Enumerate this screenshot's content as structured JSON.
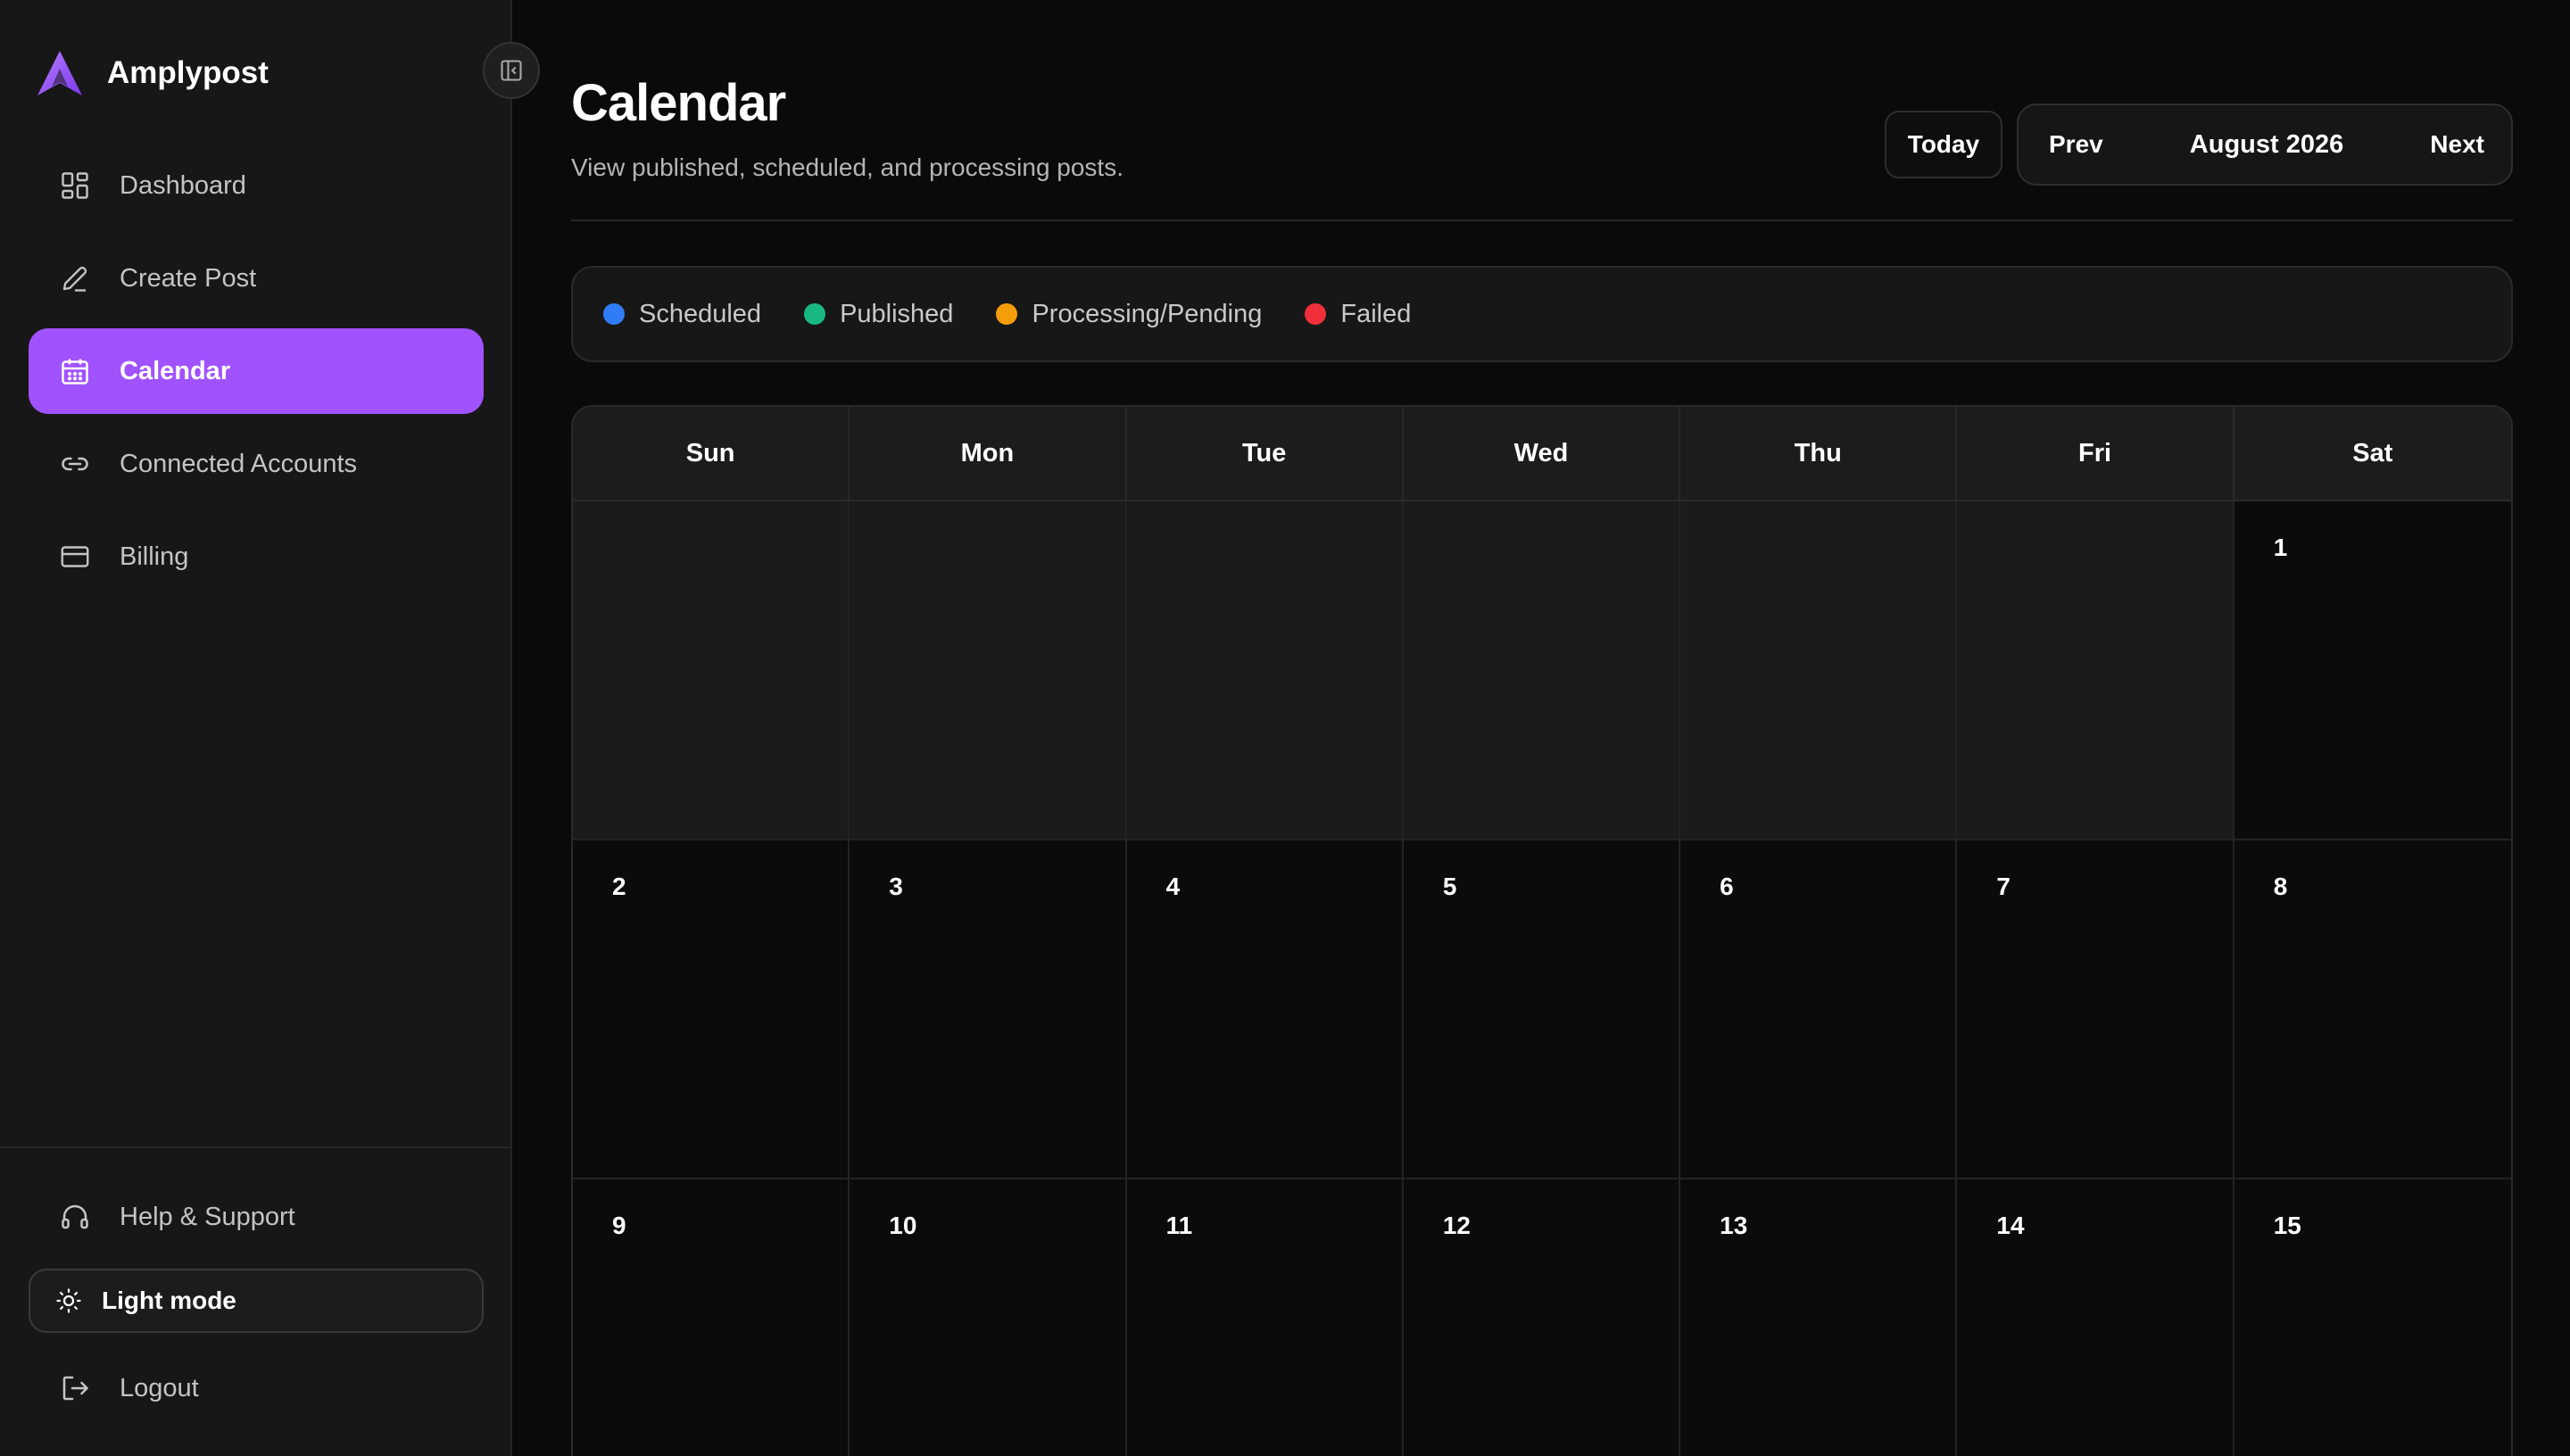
{
  "app": {
    "name": "Amplypost"
  },
  "sidebar": {
    "items": [
      {
        "label": "Dashboard",
        "icon": "dashboard-icon",
        "active": false
      },
      {
        "label": "Create Post",
        "icon": "pencil-icon",
        "active": false
      },
      {
        "label": "Calendar",
        "icon": "calendar-icon",
        "active": true
      },
      {
        "label": "Connected Accounts",
        "icon": "link-icon",
        "active": false
      },
      {
        "label": "Billing",
        "icon": "credit-card-icon",
        "active": false
      }
    ],
    "help_label": "Help & Support",
    "theme_toggle_label": "Light mode",
    "logout_label": "Logout"
  },
  "page": {
    "title": "Calendar",
    "subtitle": "View published, scheduled, and processing posts."
  },
  "controls": {
    "today_label": "Today",
    "prev_label": "Prev",
    "next_label": "Next",
    "month_label": "August 2026"
  },
  "legend": [
    {
      "label": "Scheduled",
      "color": "#2f7cf6"
    },
    {
      "label": "Published",
      "color": "#19b882"
    },
    {
      "label": "Processing/Pending",
      "color": "#f59e0b"
    },
    {
      "label": "Failed",
      "color": "#ef2f3a"
    }
  ],
  "calendar": {
    "weekdays": [
      "Sun",
      "Mon",
      "Tue",
      "Wed",
      "Thu",
      "Fri",
      "Sat"
    ],
    "leading_empty_days": 6,
    "days": [
      "1",
      "2",
      "3",
      "4",
      "5",
      "6",
      "7",
      "8",
      "9",
      "10",
      "11",
      "12",
      "13",
      "14",
      "15"
    ]
  },
  "colors": {
    "accent": "#a052ff",
    "background": "#0a0a0a",
    "sidebar": "#171717"
  }
}
